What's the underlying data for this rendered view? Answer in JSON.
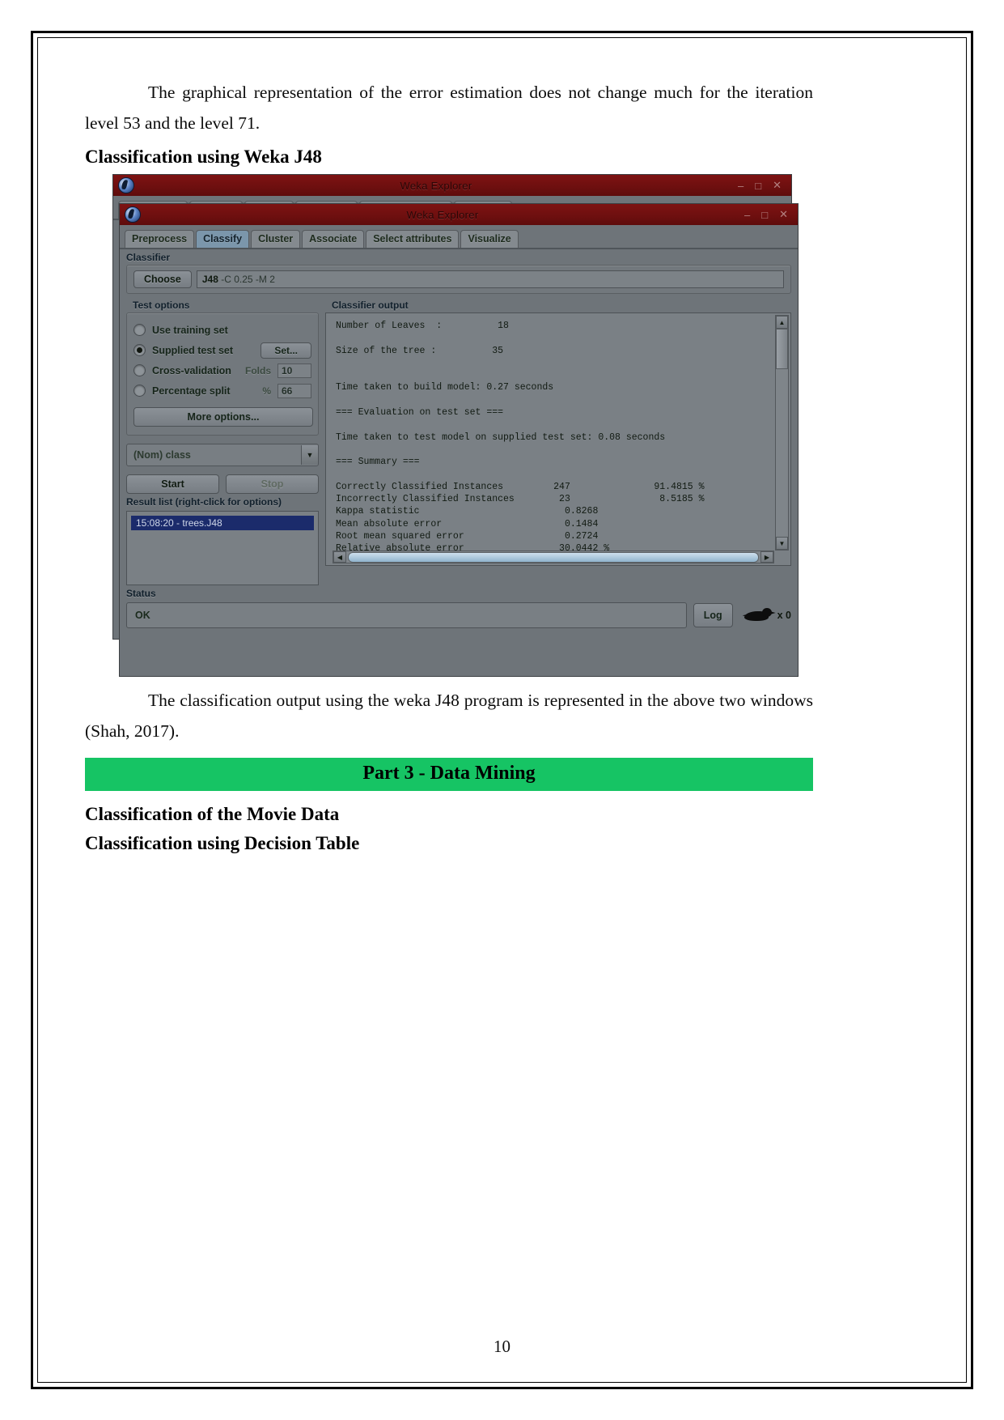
{
  "document": {
    "paragraph1_indent_lead": "The graphical representation of the error estimation does not change much for the iteration level 53 and the level 71.",
    "heading1": "Classification using Weka J48",
    "paragraph2": "The classification output using the weka J48 program is represented in the above two windows (Shah, 2017).",
    "banner": "Part 3 - Data Mining",
    "heading2": "Classification of the Movie Data",
    "heading3": "Classification using Decision Table",
    "page_number": "10"
  },
  "weka": {
    "window_title": "Weka Explorer",
    "titlebar_buttons": {
      "minimize": "–",
      "maximize": "□",
      "close": "✕"
    },
    "tabs": [
      {
        "label": "Preprocess",
        "selected": false
      },
      {
        "label": "Classify",
        "selected": true
      },
      {
        "label": "Cluster",
        "selected": false
      },
      {
        "label": "Associate",
        "selected": false
      },
      {
        "label": "Select attributes",
        "selected": false
      },
      {
        "label": "Visualize",
        "selected": false
      }
    ],
    "classifier": {
      "group_label": "Classifier",
      "choose_button": "Choose",
      "scheme_name": "J48",
      "scheme_options": "-C 0.25 -M 2"
    },
    "test_options": {
      "group_label": "Test options",
      "options": [
        {
          "label": "Use training set",
          "selected": false
        },
        {
          "label": "Supplied test set",
          "selected": true,
          "button": "Set..."
        },
        {
          "label": "Cross-validation",
          "selected": false,
          "param_label": "Folds",
          "param_value": "10"
        },
        {
          "label": "Percentage split",
          "selected": false,
          "param_label": "%",
          "param_value": "66"
        }
      ],
      "more_options_button": "More options..."
    },
    "class_selector": {
      "value": "(Nom) class",
      "arrow_icon": "chevron-down-icon"
    },
    "start_button": "Start",
    "stop_button": "Stop",
    "result_list": {
      "label": "Result list (right-click for options)",
      "items": [
        "15:08:20 - trees.J48"
      ]
    },
    "classifier_output": {
      "label": "Classifier output",
      "text": "Number of Leaves  :          18\n\nSize of the tree :          35\n\n\nTime taken to build model: 0.27 seconds\n\n=== Evaluation on test set ===\n\nTime taken to test model on supplied test set: 0.08 seconds\n\n=== Summary ===\n\nCorrectly Classified Instances         247               91.4815 %\nIncorrectly Classified Instances        23                8.5185 %\nKappa statistic                          0.8268\nMean absolute error                      0.1484\nRoot mean squared error                  0.2724\nRelative absolute error                 30.0442 %"
    },
    "status": {
      "label": "Status",
      "value": "OK",
      "log_button": "Log",
      "weka_bird_count": "x 0"
    }
  }
}
